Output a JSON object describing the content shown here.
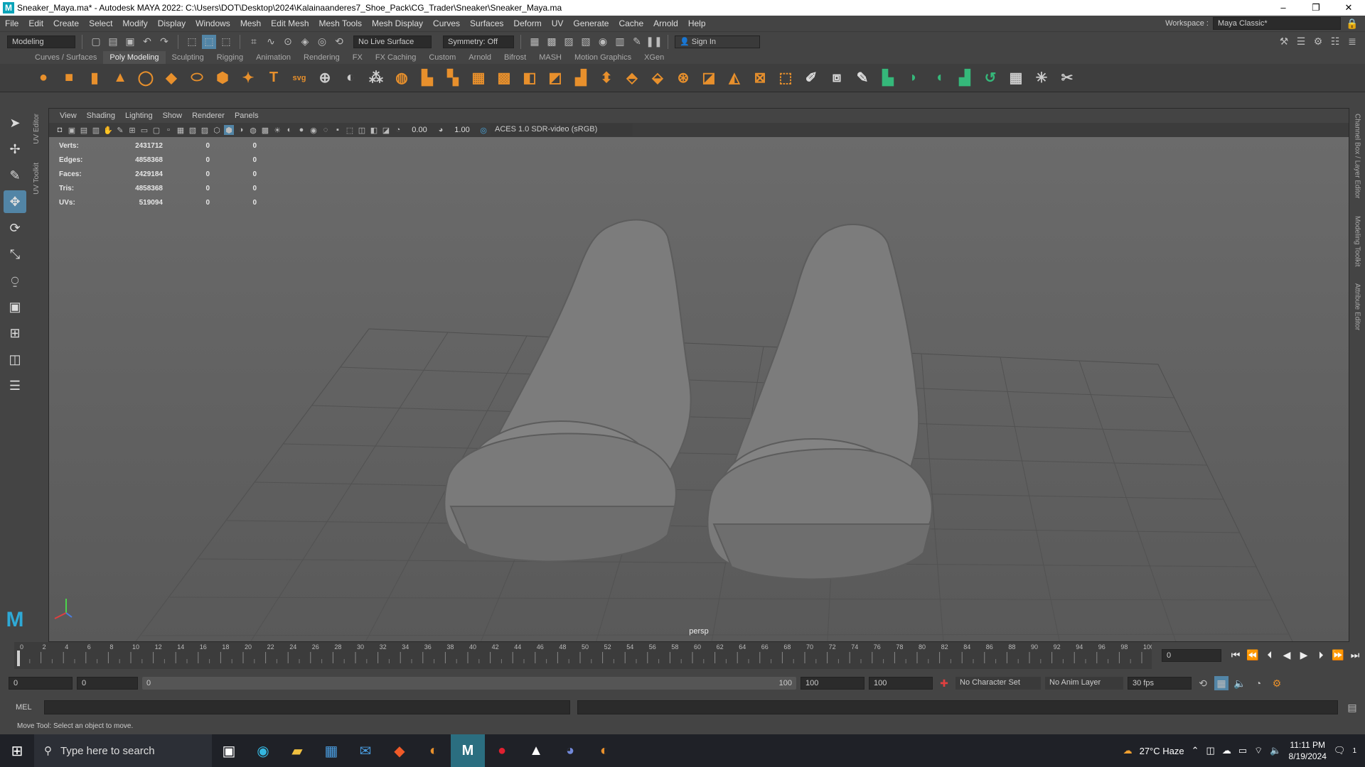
{
  "window": {
    "title": "Sneaker_Maya.ma* - Autodesk MAYA 2022: C:\\Users\\DOT\\Desktop\\2024\\Kalainaanderes7_Shoe_Pack\\CG_Trader\\Sneaker\\Sneaker_Maya.ma",
    "app_icon": "M"
  },
  "menubar": {
    "items": [
      "File",
      "Edit",
      "Create",
      "Select",
      "Modify",
      "Display",
      "Windows",
      "Mesh",
      "Edit Mesh",
      "Mesh Tools",
      "Mesh Display",
      "Curves",
      "Surfaces",
      "Deform",
      "UV",
      "Generate",
      "Cache",
      "Arnold",
      "Help"
    ],
    "workspace_label": "Workspace :",
    "workspace_value": "Maya Classic*"
  },
  "statusline": {
    "mode": "Modeling",
    "live_surface": "No Live Surface",
    "symmetry": "Symmetry: Off",
    "sign_in": "Sign In"
  },
  "shelf_tabs": [
    "Curves / Surfaces",
    "Poly Modeling",
    "Sculpting",
    "Rigging",
    "Animation",
    "Rendering",
    "FX",
    "FX Caching",
    "Custom",
    "Arnold",
    "Bifrost",
    "MASH",
    "Motion Graphics",
    "XGen"
  ],
  "shelf_active": "Poly Modeling",
  "side_labels": {
    "left_top": "UV Editor",
    "left_bottom": "UV Toolkit",
    "right": [
      "Channel Box / Layer Editor",
      "Modeling Toolkit",
      "Attribute Editor"
    ]
  },
  "panel_menu": [
    "View",
    "Shading",
    "Lighting",
    "Show",
    "Renderer",
    "Panels"
  ],
  "panel_toolbar": {
    "exposure": "0.00",
    "gamma": "1.00",
    "color_space": "ACES 1.0 SDR-video (sRGB)"
  },
  "hud": [
    {
      "label": "Verts:",
      "value": "2431712",
      "sel": "0",
      "comp": "0"
    },
    {
      "label": "Edges:",
      "value": "4858368",
      "sel": "0",
      "comp": "0"
    },
    {
      "label": "Faces:",
      "value": "2429184",
      "sel": "0",
      "comp": "0"
    },
    {
      "label": "Tris:",
      "value": "4858368",
      "sel": "0",
      "comp": "0"
    },
    {
      "label": "UVs:",
      "value": "519094",
      "sel": "0",
      "comp": "0"
    }
  ],
  "camera_label": "persp",
  "timeline": {
    "ticks": [
      "0",
      "2",
      "4",
      "6",
      "8",
      "10",
      "12",
      "14",
      "16",
      "18",
      "20",
      "22",
      "24",
      "26",
      "28",
      "30",
      "32",
      "34",
      "36",
      "38",
      "40",
      "42",
      "44",
      "46",
      "48",
      "50",
      "52",
      "54",
      "56",
      "58",
      "60",
      "62",
      "64",
      "66",
      "68",
      "70",
      "72",
      "74",
      "76",
      "78",
      "80",
      "82",
      "84",
      "86",
      "88",
      "90",
      "92",
      "94",
      "96",
      "98",
      "100"
    ],
    "current_frame": "0"
  },
  "range": {
    "start": "0",
    "start2": "0",
    "slider_left": "0",
    "slider_right": "100",
    "end": "100",
    "end2": "100",
    "character_set": "No Character Set",
    "anim_layer": "No Anim Layer",
    "fps": "30 fps"
  },
  "cmdline": {
    "lang": "MEL"
  },
  "helpline": {
    "text": "Move Tool: Select an object to move."
  },
  "taskbar": {
    "search_placeholder": "Type here to search",
    "weather": "27°C  Haze",
    "time": "11:11 PM",
    "date": "8/19/2024",
    "notifications": "1"
  }
}
